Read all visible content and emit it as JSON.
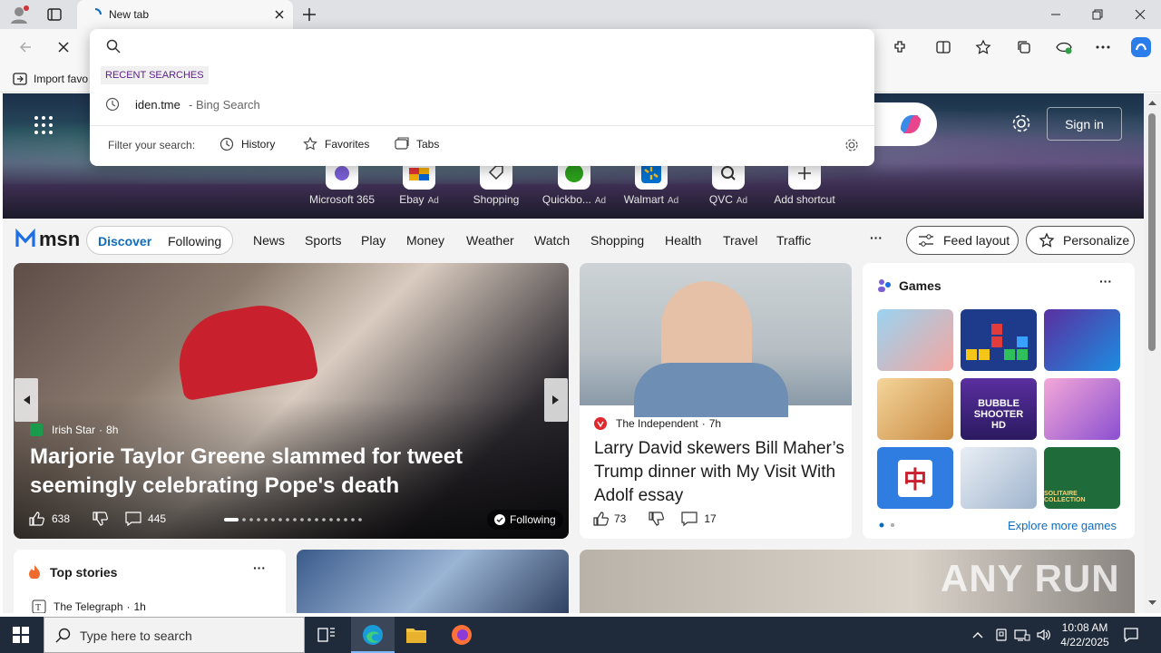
{
  "browser": {
    "tab_title": "New tab",
    "favbar_item": "Import favo"
  },
  "omnibox": {
    "recent_header": "RECENT SEARCHES",
    "recent_item_term": "iden.tme",
    "recent_item_suffix": "- Bing Search",
    "filter_label": "Filter your search:",
    "filters": [
      "History",
      "Favorites",
      "Tabs"
    ]
  },
  "hero": {
    "signin": "Sign in",
    "shortcuts": [
      {
        "label": "Microsoft 365",
        "ad": ""
      },
      {
        "label": "Ebay",
        "ad": "Ad"
      },
      {
        "label": "Shopping",
        "ad": ""
      },
      {
        "label": "Quickbo...",
        "ad": "Ad"
      },
      {
        "label": "Walmart",
        "ad": "Ad"
      },
      {
        "label": "QVC",
        "ad": "Ad"
      },
      {
        "label": "Add shortcut",
        "ad": ""
      }
    ]
  },
  "nav": {
    "brand": "msn",
    "discover": "Discover",
    "following": "Following",
    "links": [
      "News",
      "Sports",
      "Play",
      "Money",
      "Weather",
      "Watch",
      "Shopping",
      "Health",
      "Travel",
      "Traffic"
    ],
    "more": "···",
    "feed_layout": "Feed layout",
    "personalize": "Personalize"
  },
  "main_story": {
    "source": "Irish Star",
    "age": "8h",
    "headline": "Marjorie Taylor Greene slammed for tweet seemingly celebrating Pope's death",
    "likes": "638",
    "comments": "445",
    "following": "Following"
  },
  "side_story": {
    "source": "The Independent",
    "age": "7h",
    "headline": "Larry David skewers Bill Maher’s Trump dinner with My Visit With Adolf essay",
    "likes": "73",
    "comments": "17"
  },
  "games": {
    "title": "Games",
    "explore": "Explore more games",
    "tile_texts": [
      "BUBBLE SHOOTER HD",
      "SOLITAIRE COLLECTION"
    ]
  },
  "top_stories": {
    "title": "Top stories",
    "source": "The Telegraph",
    "age": "1h"
  },
  "watermark": "ANY RUN",
  "taskbar": {
    "search_placeholder": "Type here to search",
    "time": "10:08 AM",
    "date": "4/22/2025"
  },
  "colors": {
    "accent": "#0f6cbd",
    "taskbar": "#1f2a3a"
  }
}
